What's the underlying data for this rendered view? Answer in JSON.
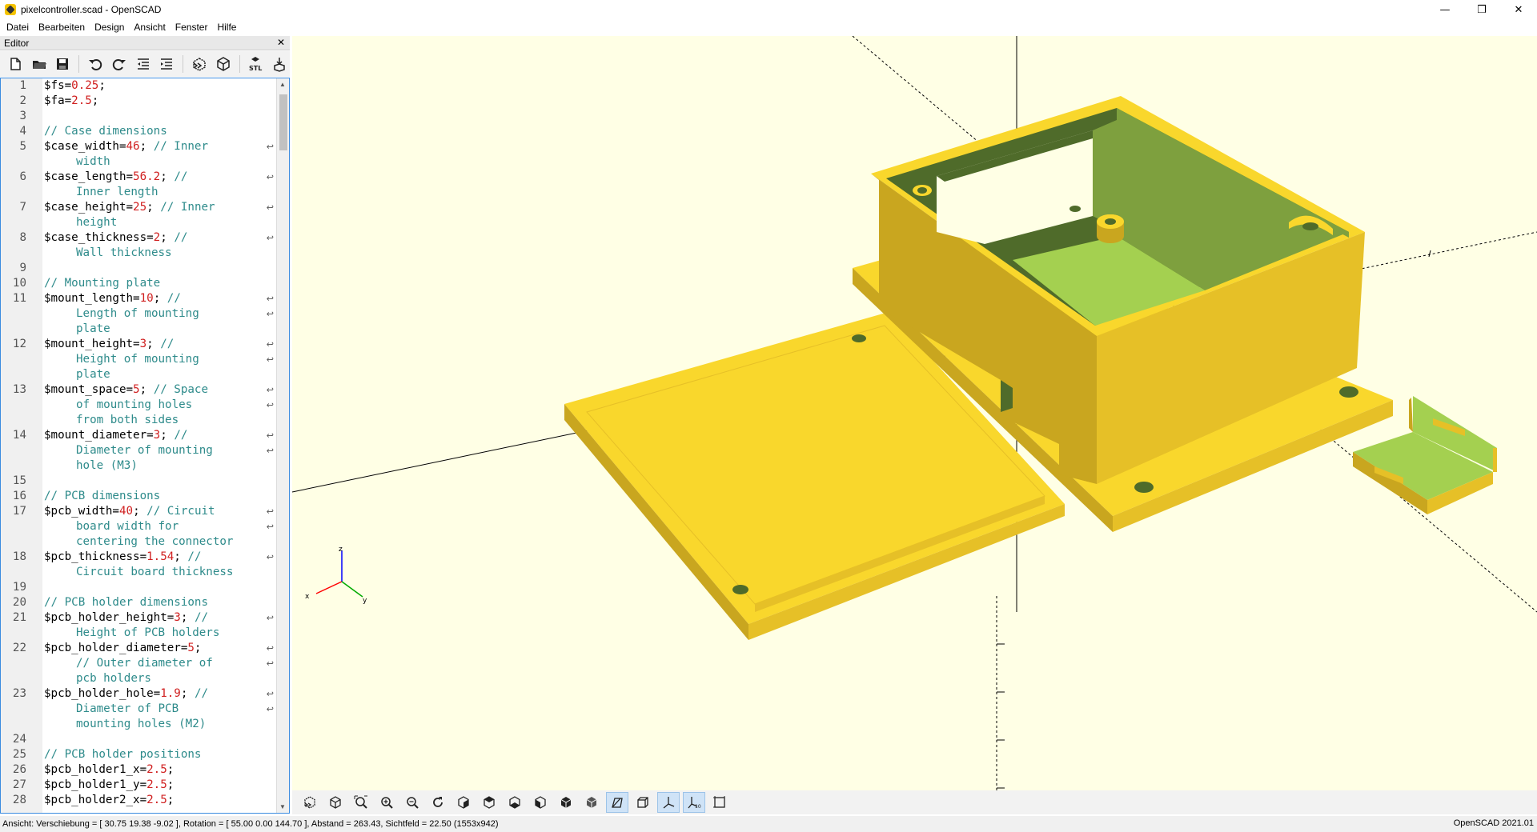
{
  "window": {
    "title": "pixelcontroller.scad - OpenSCAD",
    "minimize": "—",
    "maximize": "❒",
    "close": "✕"
  },
  "menu": [
    {
      "label": "Datei"
    },
    {
      "label": "Bearbeiten"
    },
    {
      "label": "Design"
    },
    {
      "label": "Ansicht"
    },
    {
      "label": "Fenster"
    },
    {
      "label": "Hilfe"
    }
  ],
  "editor": {
    "title": "Editor",
    "close": "✕",
    "toolbar": [
      "new-icon",
      "open-icon",
      "save-icon",
      "undo-icon",
      "redo-icon",
      "unindent-icon",
      "indent-icon",
      "preview-icon",
      "render-icon",
      "stl-export-icon",
      "send-to-print-icon"
    ],
    "lines": [
      {
        "n": "1",
        "parts": [
          [
            "$fs=",
            ""
          ],
          [
            "0.25",
            "num"
          ],
          [
            ";",
            ""
          ]
        ]
      },
      {
        "n": "2",
        "parts": [
          [
            "$fa=",
            ""
          ],
          [
            "2.5",
            "num"
          ],
          [
            ";",
            ""
          ]
        ]
      },
      {
        "n": "3",
        "parts": []
      },
      {
        "n": "4",
        "parts": [
          [
            "// Case dimensions",
            "comment"
          ]
        ]
      },
      {
        "n": "5",
        "parts": [
          [
            "$case_width=",
            ""
          ],
          [
            "46",
            "num"
          ],
          [
            "; ",
            ""
          ],
          [
            "// Inner",
            "comment"
          ]
        ],
        "wrap": true
      },
      {
        "n": "",
        "parts": [
          [
            "width",
            "comment"
          ]
        ],
        "cont": true
      },
      {
        "n": "6",
        "parts": [
          [
            "$case_length=",
            ""
          ],
          [
            "56.2",
            "num"
          ],
          [
            "; ",
            ""
          ],
          [
            "//",
            "comment"
          ]
        ],
        "wrap": true
      },
      {
        "n": "",
        "parts": [
          [
            "Inner length",
            "comment"
          ]
        ],
        "cont": true
      },
      {
        "n": "7",
        "parts": [
          [
            "$case_height=",
            ""
          ],
          [
            "25",
            "num"
          ],
          [
            "; ",
            ""
          ],
          [
            "// Inner",
            "comment"
          ]
        ],
        "wrap": true
      },
      {
        "n": "",
        "parts": [
          [
            "height",
            "comment"
          ]
        ],
        "cont": true
      },
      {
        "n": "8",
        "parts": [
          [
            "$case_thickness=",
            ""
          ],
          [
            "2",
            "num"
          ],
          [
            "; ",
            ""
          ],
          [
            "//",
            "comment"
          ]
        ],
        "wrap": true
      },
      {
        "n": "",
        "parts": [
          [
            "Wall thickness",
            "comment"
          ]
        ],
        "cont": true
      },
      {
        "n": "9",
        "parts": []
      },
      {
        "n": "10",
        "parts": [
          [
            "// Mounting plate",
            "comment"
          ]
        ]
      },
      {
        "n": "11",
        "parts": [
          [
            "$mount_length=",
            ""
          ],
          [
            "10",
            "num"
          ],
          [
            "; ",
            ""
          ],
          [
            "//",
            "comment"
          ]
        ],
        "wrap": true
      },
      {
        "n": "",
        "parts": [
          [
            "Length of mounting",
            "comment"
          ]
        ],
        "cont": true,
        "wrap": true
      },
      {
        "n": "",
        "parts": [
          [
            "plate",
            "comment"
          ]
        ],
        "cont": true
      },
      {
        "n": "12",
        "parts": [
          [
            "$mount_height=",
            ""
          ],
          [
            "3",
            "num"
          ],
          [
            "; ",
            ""
          ],
          [
            "//",
            "comment"
          ]
        ],
        "wrap": true
      },
      {
        "n": "",
        "parts": [
          [
            "Height of mounting",
            "comment"
          ]
        ],
        "cont": true,
        "wrap": true
      },
      {
        "n": "",
        "parts": [
          [
            "plate",
            "comment"
          ]
        ],
        "cont": true
      },
      {
        "n": "13",
        "parts": [
          [
            "$mount_space=",
            ""
          ],
          [
            "5",
            "num"
          ],
          [
            "; ",
            ""
          ],
          [
            "// Space",
            "comment"
          ]
        ],
        "wrap": true
      },
      {
        "n": "",
        "parts": [
          [
            "of mounting holes",
            "comment"
          ]
        ],
        "cont": true,
        "wrap": true
      },
      {
        "n": "",
        "parts": [
          [
            "from both sides",
            "comment"
          ]
        ],
        "cont": true
      },
      {
        "n": "14",
        "parts": [
          [
            "$mount_diameter=",
            ""
          ],
          [
            "3",
            "num"
          ],
          [
            "; ",
            ""
          ],
          [
            "//",
            "comment"
          ]
        ],
        "wrap": true
      },
      {
        "n": "",
        "parts": [
          [
            "Diameter of mounting",
            "comment"
          ]
        ],
        "cont": true,
        "wrap": true
      },
      {
        "n": "",
        "parts": [
          [
            "hole (M3)",
            "comment"
          ]
        ],
        "cont": true
      },
      {
        "n": "15",
        "parts": []
      },
      {
        "n": "16",
        "parts": [
          [
            "// PCB dimensions",
            "comment"
          ]
        ]
      },
      {
        "n": "17",
        "parts": [
          [
            "$pcb_width=",
            ""
          ],
          [
            "40",
            "num"
          ],
          [
            "; ",
            ""
          ],
          [
            "// Circuit",
            "comment"
          ]
        ],
        "wrap": true
      },
      {
        "n": "",
        "parts": [
          [
            "board width for",
            "comment"
          ]
        ],
        "cont": true,
        "wrap": true
      },
      {
        "n": "",
        "parts": [
          [
            "centering the connector",
            "comment"
          ]
        ],
        "cont": true
      },
      {
        "n": "18",
        "parts": [
          [
            "$pcb_thickness=",
            ""
          ],
          [
            "1.54",
            "num"
          ],
          [
            "; ",
            ""
          ],
          [
            "//",
            "comment"
          ]
        ],
        "wrap": true
      },
      {
        "n": "",
        "parts": [
          [
            "Circuit board thickness",
            "comment"
          ]
        ],
        "cont": true
      },
      {
        "n": "19",
        "parts": []
      },
      {
        "n": "20",
        "parts": [
          [
            "// PCB holder dimensions",
            "comment"
          ]
        ]
      },
      {
        "n": "21",
        "parts": [
          [
            "$pcb_holder_height=",
            ""
          ],
          [
            "3",
            "num"
          ],
          [
            "; ",
            ""
          ],
          [
            "//",
            "comment"
          ]
        ],
        "wrap": true
      },
      {
        "n": "",
        "parts": [
          [
            "Height of PCB holders",
            "comment"
          ]
        ],
        "cont": true
      },
      {
        "n": "22",
        "parts": [
          [
            "$pcb_holder_diameter=",
            ""
          ],
          [
            "5",
            "num"
          ],
          [
            ";",
            ""
          ]
        ],
        "wrap": true
      },
      {
        "n": "",
        "parts": [
          [
            "// Outer diameter of",
            "comment"
          ]
        ],
        "cont": true,
        "wrap": true
      },
      {
        "n": "",
        "parts": [
          [
            "pcb holders",
            "comment"
          ]
        ],
        "cont": true
      },
      {
        "n": "23",
        "parts": [
          [
            "$pcb_holder_hole=",
            ""
          ],
          [
            "1.9",
            "num"
          ],
          [
            "; ",
            ""
          ],
          [
            "//",
            "comment"
          ]
        ],
        "wrap": true
      },
      {
        "n": "",
        "parts": [
          [
            "Diameter of PCB",
            "comment"
          ]
        ],
        "cont": true,
        "wrap": true
      },
      {
        "n": "",
        "parts": [
          [
            "mounting holes (M2)",
            "comment"
          ]
        ],
        "cont": true
      },
      {
        "n": "24",
        "parts": []
      },
      {
        "n": "25",
        "parts": [
          [
            "// PCB holder positions",
            "comment"
          ]
        ]
      },
      {
        "n": "26",
        "parts": [
          [
            "$pcb_holder1_x=",
            ""
          ],
          [
            "2.5",
            "num"
          ],
          [
            ";",
            ""
          ]
        ]
      },
      {
        "n": "27",
        "parts": [
          [
            "$pcb_holder1_y=",
            ""
          ],
          [
            "2.5",
            "num"
          ],
          [
            ";",
            ""
          ]
        ]
      },
      {
        "n": "28",
        "parts": [
          [
            "$pcb_holder2_x=",
            ""
          ],
          [
            "2.5",
            "num"
          ],
          [
            ";",
            ""
          ]
        ]
      }
    ]
  },
  "viewport": {
    "axis_labels": {
      "z": "z",
      "x": "x",
      "y": "y"
    },
    "colors": {
      "background": "#ffffe5",
      "body": "#f9d72c",
      "body_dark": "#c9a61f",
      "body_mid": "#e6c027",
      "inner": "#a4d050",
      "inner_dark": "#4f6b2a",
      "inner_mid": "#7ea03e"
    }
  },
  "view_toolbar": [
    "preview-icon",
    "render-icon",
    "zoom-all-icon",
    "zoom-in-icon",
    "zoom-out-icon",
    "reset-view-icon",
    "view-right-icon",
    "view-top-icon",
    "view-bottom-icon",
    "view-left-icon",
    "view-front-icon",
    "view-back-icon",
    "perspective-icon",
    "orthogonal-icon",
    "show-axes-icon",
    "show-scale-icon",
    "show-edges-icon"
  ],
  "status": {
    "text": "Ansicht: Verschiebung = [ 30.75 19.38 -9.02 ], Rotation = [ 55.00 0.00 144.70 ], Abstand = 263.43, Sichtfeld = 22.50 (1553x942)",
    "version": "OpenSCAD 2021.01"
  }
}
